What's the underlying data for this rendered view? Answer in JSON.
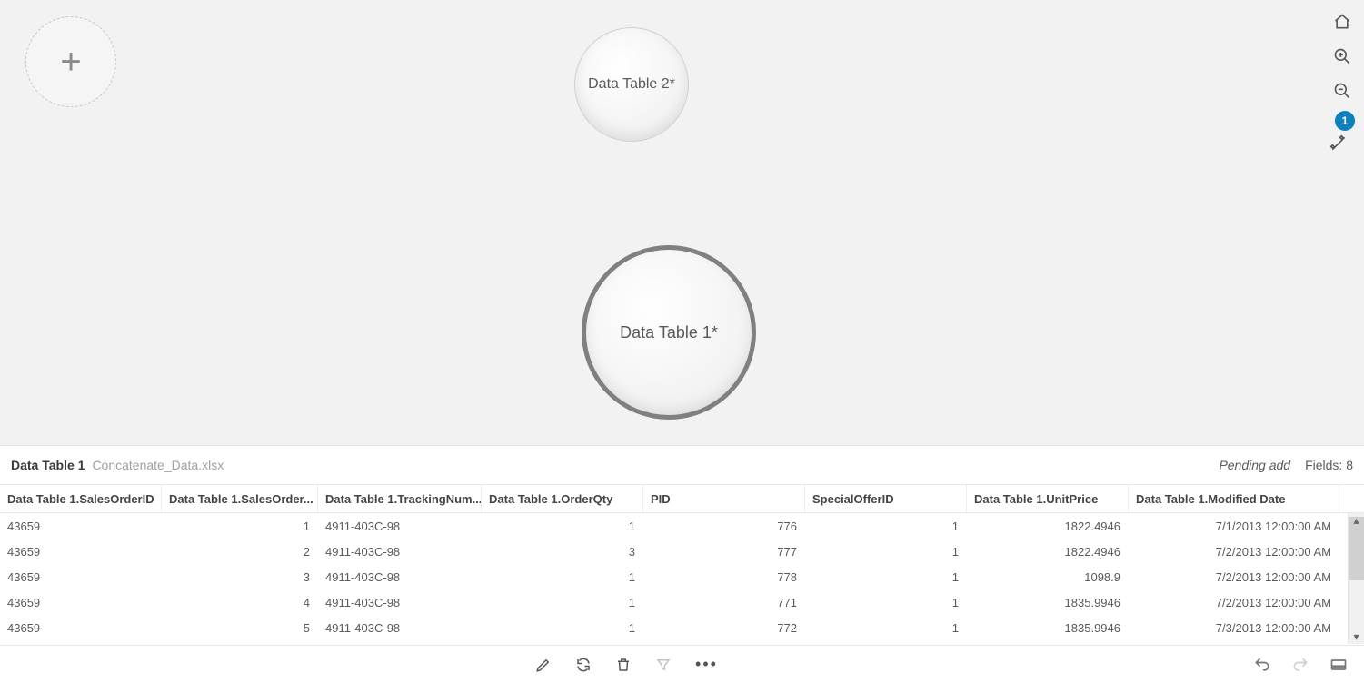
{
  "canvas": {
    "add_button": "+",
    "bubbles": [
      {
        "label": "Data Table 2*",
        "size": "small"
      },
      {
        "label": "Data Table 1*",
        "size": "large"
      }
    ]
  },
  "right_toolbar": {
    "badge": "1"
  },
  "panel": {
    "name": "Data Table 1",
    "file": "Concatenate_Data.xlsx",
    "pending": "Pending add",
    "fields_label": "Fields: 8"
  },
  "table": {
    "columns": [
      "Data Table 1.SalesOrderID",
      "Data Table 1.SalesOrder...",
      "Data Table 1.TrackingNum...",
      "Data Table 1.OrderQty",
      "PID",
      "SpecialOfferID",
      "Data Table 1.UnitPrice",
      "Data Table 1.Modified Date"
    ],
    "rows": [
      {
        "c0": "43659",
        "c1": "1",
        "c2": "4911-403C-98",
        "c3": "1",
        "c4": "776",
        "c5": "1",
        "c6": "1822.4946",
        "c7": "7/1/2013 12:00:00 AM"
      },
      {
        "c0": "43659",
        "c1": "2",
        "c2": "4911-403C-98",
        "c3": "3",
        "c4": "777",
        "c5": "1",
        "c6": "1822.4946",
        "c7": "7/2/2013 12:00:00 AM"
      },
      {
        "c0": "43659",
        "c1": "3",
        "c2": "4911-403C-98",
        "c3": "1",
        "c4": "778",
        "c5": "1",
        "c6": "1098.9",
        "c7": "7/2/2013 12:00:00 AM"
      },
      {
        "c0": "43659",
        "c1": "4",
        "c2": "4911-403C-98",
        "c3": "1",
        "c4": "771",
        "c5": "1",
        "c6": "1835.9946",
        "c7": "7/2/2013 12:00:00 AM"
      },
      {
        "c0": "43659",
        "c1": "5",
        "c2": "4911-403C-98",
        "c3": "1",
        "c4": "772",
        "c5": "1",
        "c6": "1835.9946",
        "c7": "7/3/2013 12:00:00 AM"
      }
    ]
  }
}
